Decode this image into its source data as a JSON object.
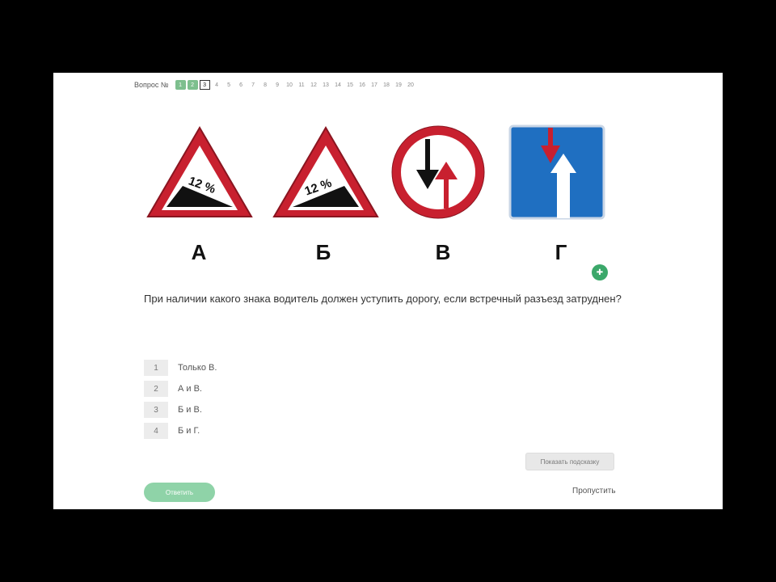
{
  "nav": {
    "label": "Вопрос №",
    "cells": [
      {
        "num": "1",
        "state": "done"
      },
      {
        "num": "2",
        "state": "done"
      },
      {
        "num": "3",
        "state": "current"
      },
      {
        "num": "4",
        "state": "todo"
      },
      {
        "num": "5",
        "state": "todo"
      },
      {
        "num": "6",
        "state": "todo"
      },
      {
        "num": "7",
        "state": "todo"
      },
      {
        "num": "8",
        "state": "todo"
      },
      {
        "num": "9",
        "state": "todo"
      },
      {
        "num": "10",
        "state": "todo"
      },
      {
        "num": "11",
        "state": "todo"
      },
      {
        "num": "12",
        "state": "todo"
      },
      {
        "num": "13",
        "state": "todo"
      },
      {
        "num": "14",
        "state": "todo"
      },
      {
        "num": "15",
        "state": "todo"
      },
      {
        "num": "16",
        "state": "todo"
      },
      {
        "num": "17",
        "state": "todo"
      },
      {
        "num": "18",
        "state": "todo"
      },
      {
        "num": "19",
        "state": "todo"
      },
      {
        "num": "20",
        "state": "todo"
      }
    ]
  },
  "signs": [
    {
      "letter": "А",
      "kind": "steep-descent",
      "text": "12 %"
    },
    {
      "letter": "Б",
      "kind": "steep-ascent",
      "text": "12 %"
    },
    {
      "letter": "В",
      "kind": "priority-oncoming-give-way"
    },
    {
      "letter": "Г",
      "kind": "priority-over-oncoming"
    }
  ],
  "colors": {
    "sign_red": "#c8202f",
    "sign_blue": "#1f6fc1",
    "accent_green": "#3ba86a"
  },
  "question": "При наличии какого знака водитель должен уступить дорогу, если встречный разъезд затруднен?",
  "answers": [
    {
      "num": "1",
      "text": "Только В."
    },
    {
      "num": "2",
      "text": "А и В."
    },
    {
      "num": "3",
      "text": "Б и В."
    },
    {
      "num": "4",
      "text": "Б и Г."
    }
  ],
  "buttons": {
    "hint": "Показать подсказку",
    "answer": "Ответить",
    "skip": "Пропустить"
  }
}
